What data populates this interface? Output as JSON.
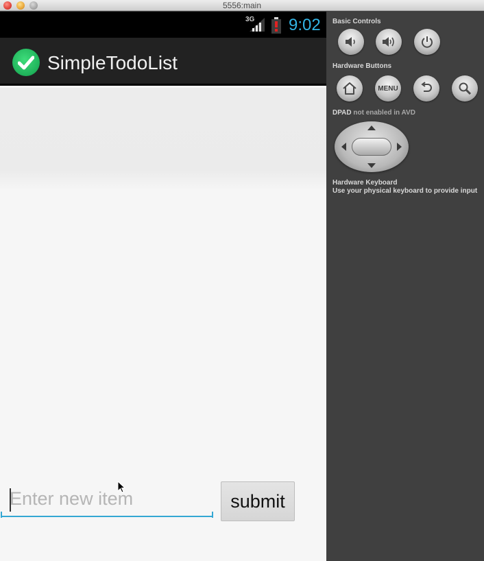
{
  "window": {
    "title": "5556:main"
  },
  "status_bar": {
    "network": "3G",
    "time": "9:02",
    "time_color": "#33b5e5"
  },
  "app": {
    "title": "SimpleTodoList",
    "icon": "checkmark-circle-icon",
    "icon_color": "#1fb25a"
  },
  "form": {
    "input_placeholder": "Enter new item",
    "input_value": "",
    "submit_label": "submit",
    "accent": "#33a7d3"
  },
  "panel": {
    "basic_controls_label": "Basic Controls",
    "basic_controls": [
      {
        "name": "volume-down-icon"
      },
      {
        "name": "volume-up-icon"
      },
      {
        "name": "power-icon"
      }
    ],
    "hardware_buttons_label": "Hardware Buttons",
    "hardware_buttons": [
      {
        "name": "home-icon"
      },
      {
        "name": "menu-button",
        "label": "MENU"
      },
      {
        "name": "back-icon"
      },
      {
        "name": "search-icon"
      }
    ],
    "dpad_label": "DPAD",
    "dpad_note": "not enabled in AVD",
    "keyboard_label": "Hardware Keyboard",
    "keyboard_desc": "Use your physical keyboard to provide input"
  }
}
